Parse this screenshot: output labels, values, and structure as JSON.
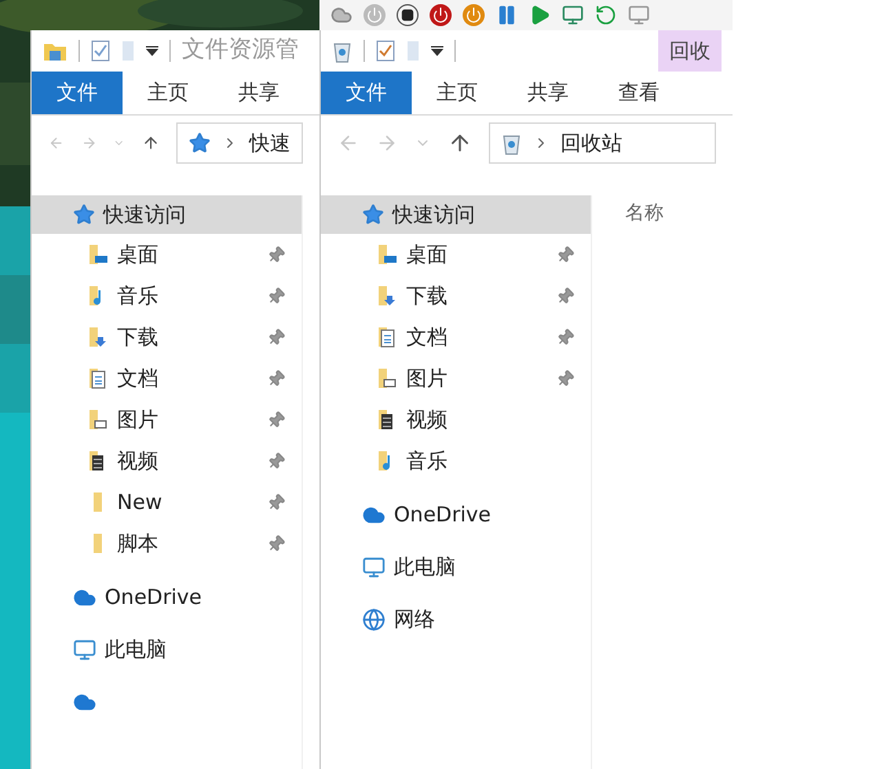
{
  "windows": [
    {
      "title": "文件资源管",
      "tabs": [
        {
          "label": "文件",
          "selected": true
        },
        {
          "label": "主页",
          "selected": false
        },
        {
          "label": "共享",
          "selected": false
        }
      ],
      "address": {
        "kind": "star",
        "text": "快速"
      },
      "nav": [
        {
          "label": "快速访问",
          "kind": "star",
          "selected": true,
          "children": [
            {
              "label": "桌面",
              "kind": "desktop",
              "pinned": true
            },
            {
              "label": "音乐",
              "kind": "music",
              "pinned": true
            },
            {
              "label": "下载",
              "kind": "download",
              "pinned": true
            },
            {
              "label": "文档",
              "kind": "document",
              "pinned": true
            },
            {
              "label": "图片",
              "kind": "pictures",
              "pinned": true
            },
            {
              "label": "视频",
              "kind": "video",
              "pinned": true
            },
            {
              "label": "New",
              "kind": "folder",
              "pinned": true
            },
            {
              "label": "脚本",
              "kind": "folder",
              "pinned": true
            }
          ]
        },
        {
          "label": "OneDrive",
          "kind": "cloud",
          "selected": false
        },
        {
          "label": "此电脑",
          "kind": "pc",
          "selected": false
        },
        {
          "kind": "cloud",
          "selected": false
        }
      ]
    },
    {
      "context_tab": "回收",
      "tabs": [
        {
          "label": "文件",
          "selected": true
        },
        {
          "label": "主页",
          "selected": false
        },
        {
          "label": "共享",
          "selected": false
        },
        {
          "label": "查看",
          "selected": false
        }
      ],
      "address": {
        "kind": "bin",
        "text": "回收站"
      },
      "column_header": "名称",
      "nav": [
        {
          "label": "快速访问",
          "kind": "star",
          "selected": true,
          "children": [
            {
              "label": "桌面",
              "kind": "desktop",
              "pinned": true
            },
            {
              "label": "下载",
              "kind": "download",
              "pinned": true
            },
            {
              "label": "文档",
              "kind": "document",
              "pinned": true
            },
            {
              "label": "图片",
              "kind": "pictures",
              "pinned": true
            },
            {
              "label": "视频",
              "kind": "video",
              "pinned": false
            },
            {
              "label": "音乐",
              "kind": "music",
              "pinned": false
            }
          ]
        },
        {
          "label": "OneDrive",
          "kind": "cloud",
          "selected": false
        },
        {
          "label": "此电脑",
          "kind": "pc",
          "selected": false
        },
        {
          "label": "网络",
          "kind": "network",
          "selected": false
        }
      ]
    }
  ]
}
